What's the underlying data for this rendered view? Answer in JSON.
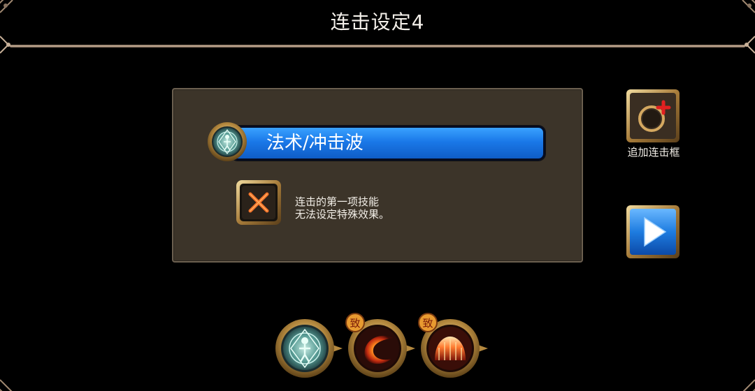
{
  "header": {
    "title": "连击设定4"
  },
  "panel": {
    "skill_label": "法术/冲击波",
    "note_line1": "连击的第一项技能",
    "note_line2": "无法设定特殊效果。"
  },
  "side": {
    "add_frame_label": "追加连击框"
  },
  "combo_slots": [
    {
      "icon": "arcane-circle-icon",
      "badge": null
    },
    {
      "icon": "fire-slash-icon",
      "badge": "致"
    },
    {
      "icon": "flame-dome-icon",
      "badge": "致"
    }
  ],
  "colors": {
    "skill_bar": "#1a78e8",
    "panel_bg": "#3c3429",
    "gold_frame": "#c8a060",
    "play_blue": "#1e7ce0"
  }
}
